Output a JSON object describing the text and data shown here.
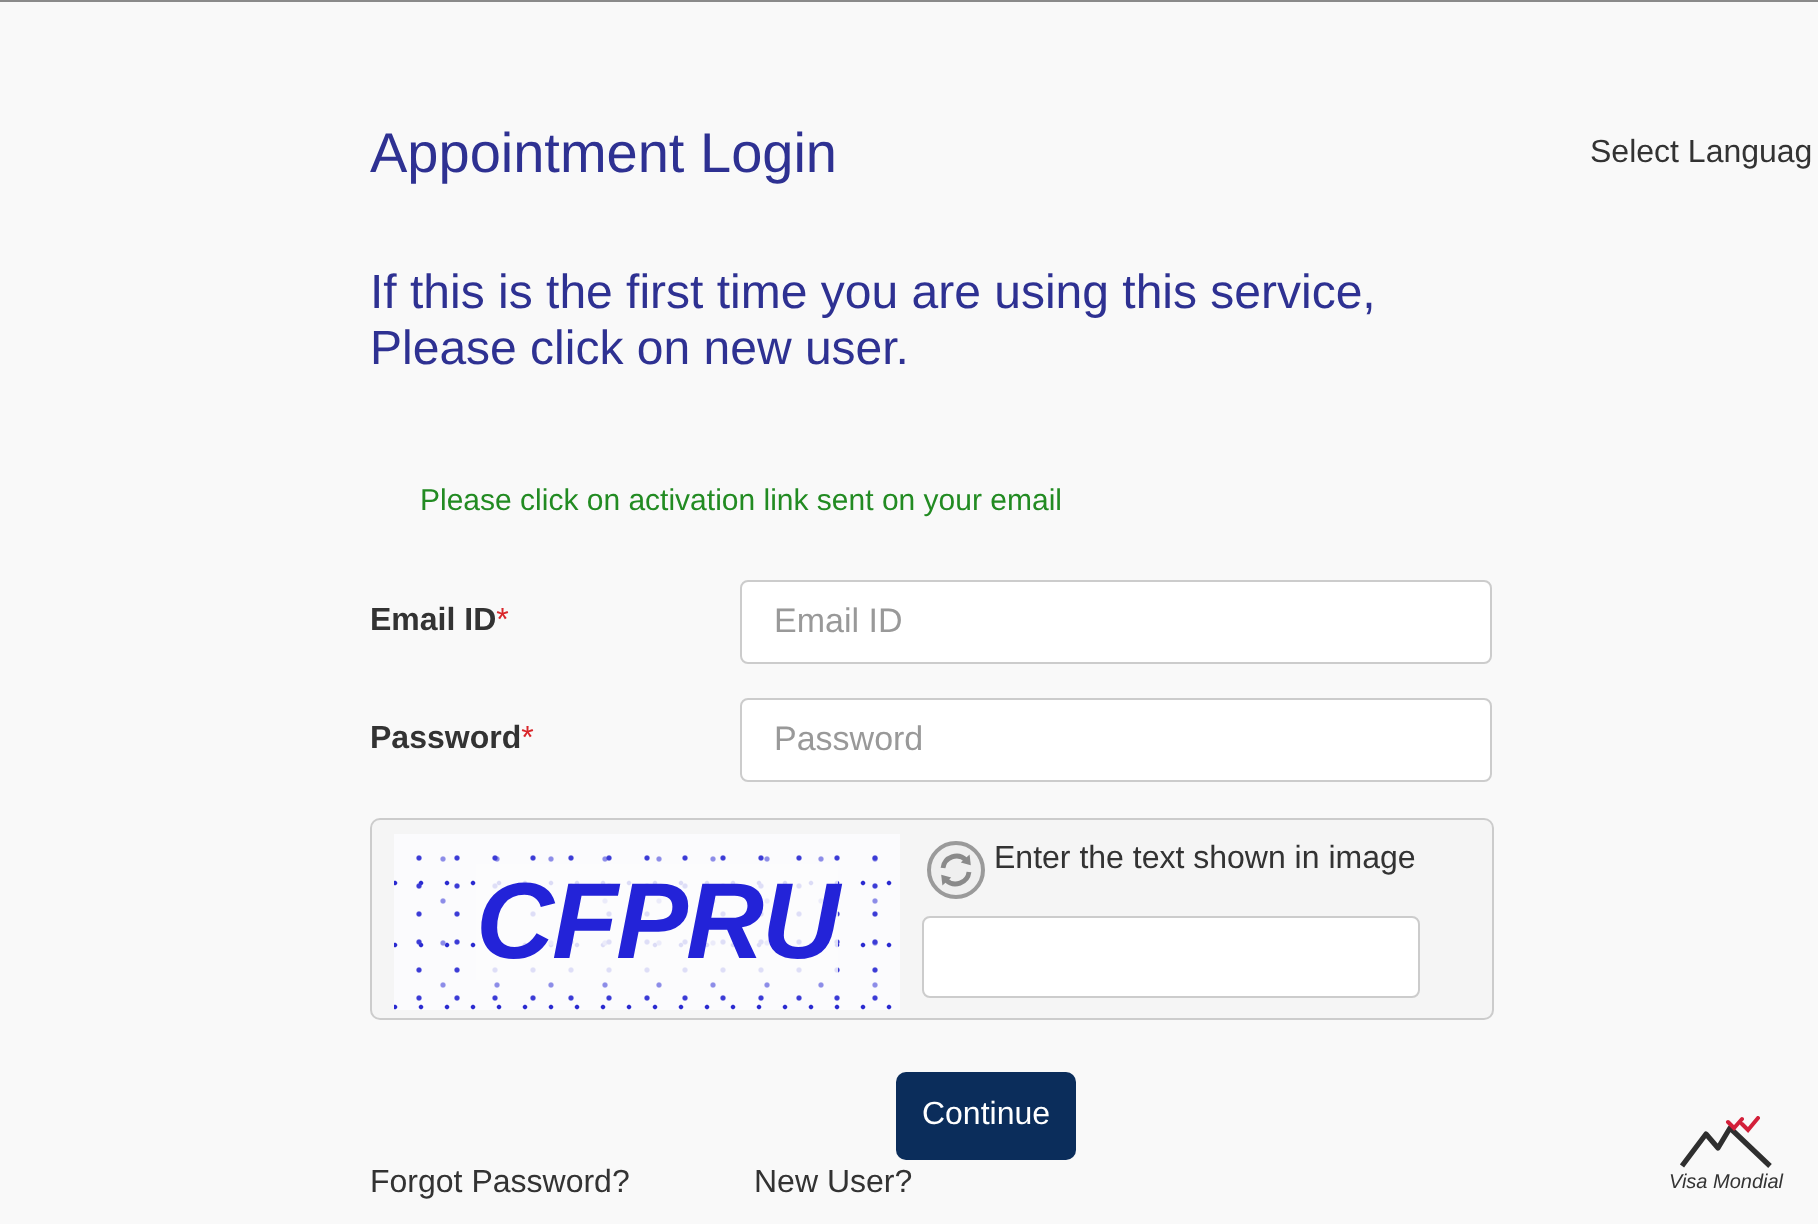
{
  "header": {
    "title": "Appointment Login",
    "language_selector": "Select Languag"
  },
  "intro": {
    "lines": [
      "If this is the first time you are using this service,",
      "Please click on new user."
    ]
  },
  "notice": "Please click on activation link sent on your email",
  "fields": [
    {
      "label": "Email ID",
      "required_mark": "*",
      "placeholder": "Email ID"
    },
    {
      "label": "Password",
      "required_mark": "*",
      "placeholder": "Password"
    }
  ],
  "captcha": {
    "image_text": "CFPRU",
    "prompt": "Enter the text shown in image"
  },
  "submit_button": "Continue",
  "links": [
    "Forgot Password?",
    "New User?"
  ],
  "logo": {
    "name": "Visa Mondial"
  }
}
